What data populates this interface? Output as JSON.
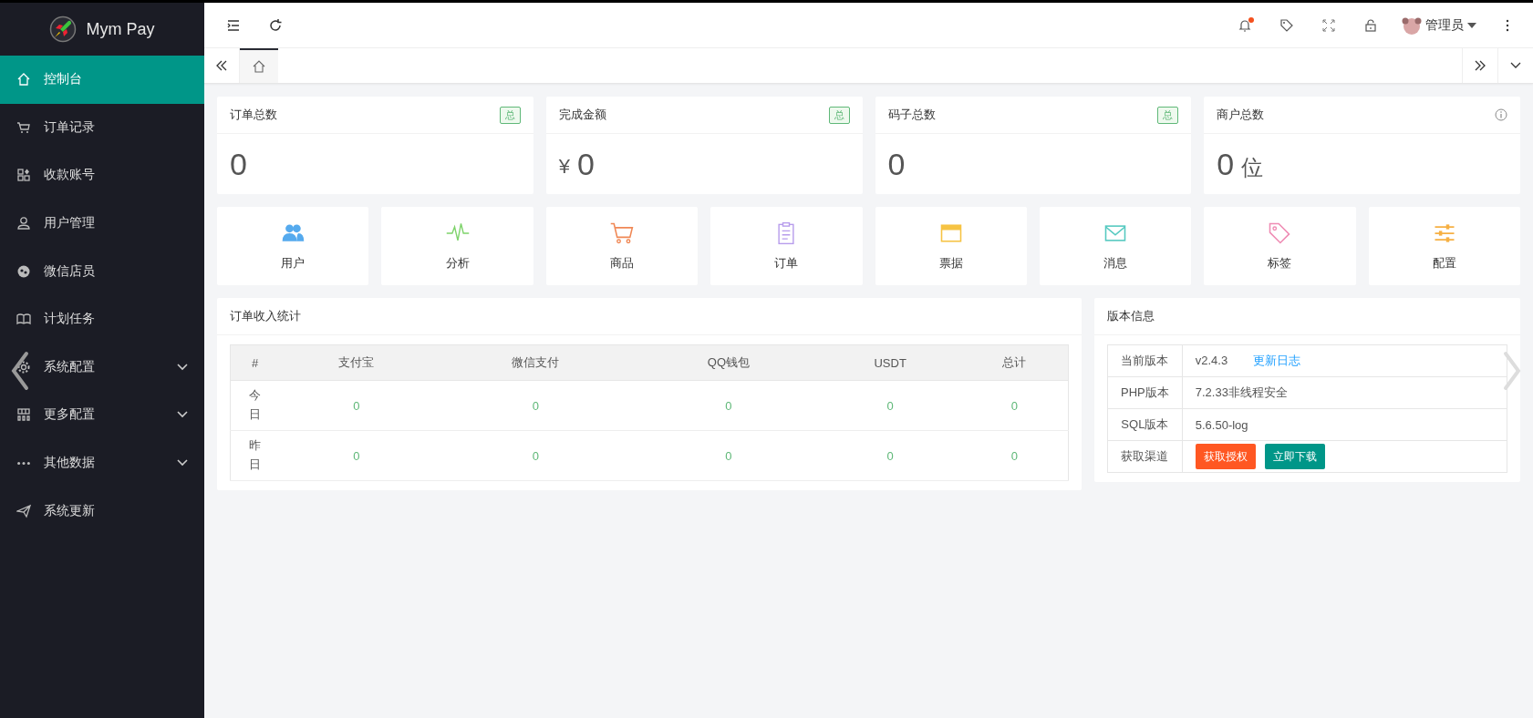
{
  "sidebar": {
    "logo_text": "Mym Pay",
    "items": [
      {
        "label": "控制台",
        "selected": true,
        "has_submenu": false
      },
      {
        "label": "订单记录",
        "selected": false,
        "has_submenu": false
      },
      {
        "label": "收款账号",
        "selected": false,
        "has_submenu": false
      },
      {
        "label": "用户管理",
        "selected": false,
        "has_submenu": false
      },
      {
        "label": "微信店员",
        "selected": false,
        "has_submenu": false
      },
      {
        "label": "计划任务",
        "selected": false,
        "has_submenu": false
      },
      {
        "label": "系统配置",
        "selected": false,
        "has_submenu": true
      },
      {
        "label": "更多配置",
        "selected": false,
        "has_submenu": true
      },
      {
        "label": "其他数据",
        "selected": false,
        "has_submenu": true
      },
      {
        "label": "系统更新",
        "selected": false,
        "has_submenu": false
      }
    ]
  },
  "header": {
    "has_notification": true,
    "user": "管理员"
  },
  "tabs": [
    {
      "selected": true
    }
  ],
  "stat_cards": [
    {
      "title": "订单总数",
      "badge": "总",
      "value": "0"
    },
    {
      "title": "完成金额",
      "badge": "总",
      "prefix": "¥",
      "value": "0"
    },
    {
      "title": "码子总数",
      "badge": "总",
      "value": "0"
    },
    {
      "title": "商户总数",
      "value": "0",
      "suffix": "位"
    }
  ],
  "shortcuts": [
    {
      "label": "用户"
    },
    {
      "label": "分析"
    },
    {
      "label": "商品"
    },
    {
      "label": "订单"
    },
    {
      "label": "票据"
    },
    {
      "label": "消息"
    },
    {
      "label": "标签"
    },
    {
      "label": "配置"
    }
  ],
  "order_stats": {
    "title": "订单收入统计",
    "columns": [
      "#",
      "支付宝",
      "微信支付",
      "QQ钱包",
      "USDT",
      "总计"
    ],
    "rows": [
      {
        "cells": [
          "今日",
          "0",
          "0",
          "0",
          "0",
          "0"
        ]
      },
      {
        "cells": [
          "昨日",
          "0",
          "0",
          "0",
          "0",
          "0"
        ]
      }
    ]
  },
  "version_info": {
    "title": "版本信息",
    "rows": [
      {
        "kind": "text",
        "label": "当前版本",
        "value": "v2.4.3",
        "link": "更新日志"
      },
      {
        "kind": "text",
        "label": "PHP版本",
        "value": "7.2.33非线程安全"
      },
      {
        "kind": "text",
        "label": "SQL版本",
        "value": "5.6.50-log"
      },
      {
        "kind": "buttons",
        "label": "获取渠道",
        "buttons": [
          {
            "label": "获取授权",
            "kind": "danger"
          },
          {
            "label": "立即下载",
            "kind": "primary"
          }
        ]
      }
    ]
  }
}
